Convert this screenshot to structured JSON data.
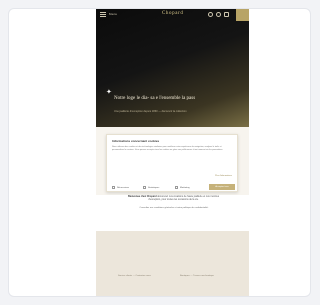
{
  "site": {
    "menu_label": "Menu",
    "brand": "Chopard"
  },
  "hero": {
    "headline": "Notre loge le dia- sa e l'ensemble la pass",
    "subhead": "Une joaillerie d'exception depuis 1860 — découvrir la collection"
  },
  "consent": {
    "title": "Informations concernant cookies",
    "text": "Nous utilisons des cookies et des technologies similaires pour améliorer votre expérience de navigation, analyser le trafic et personnaliser le contenu. Vous pouvez accepter tous les cookies ou gérer vos préférences à tout moment via les paramètres.",
    "link": "Plus d'informations",
    "options": [
      "Nécessaires",
      "Statistiques",
      "Marketing"
    ],
    "accept_label": "Accepter tous"
  },
  "intro": {
    "strong": "Bienvenue chez Chopard",
    "text": "découvrez nos créations de haute joaillerie et nos montres d'exception, pour toutes les occasions de la vie.",
    "note": "Consultez nos conditions générales et notre politique de confidentialité."
  },
  "footer": {
    "col1": "Service clients — Contactez-nous",
    "col2": "Boutiques — Trouver une boutique"
  }
}
